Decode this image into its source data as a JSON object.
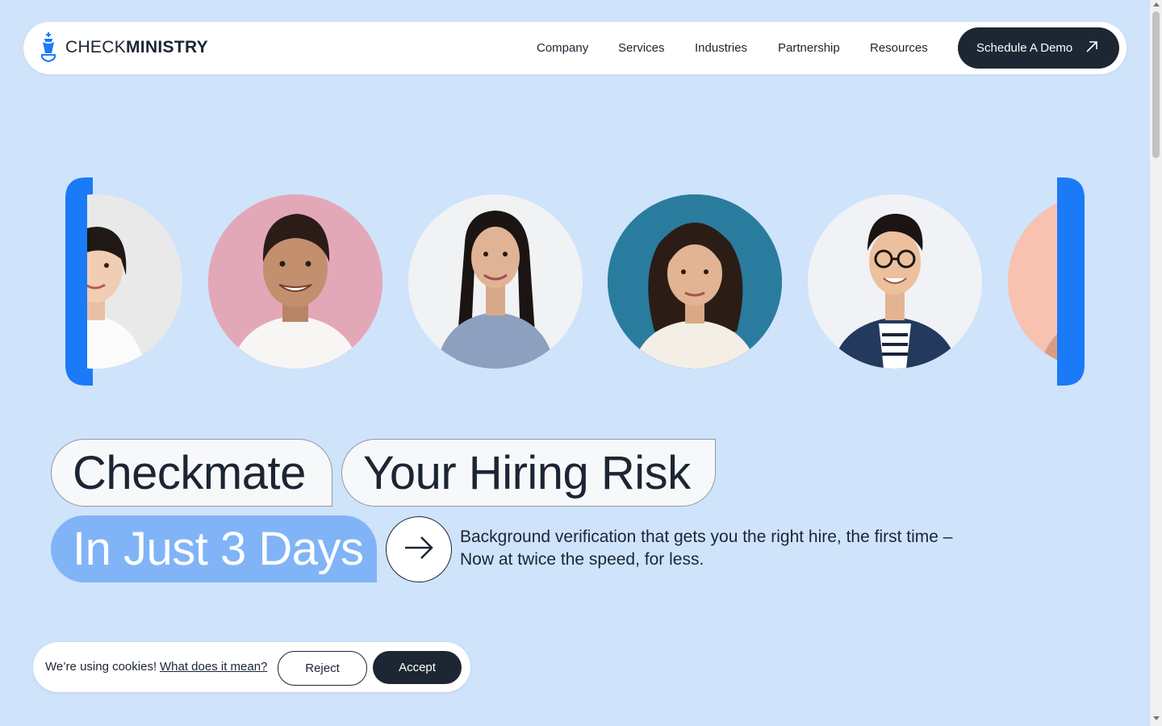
{
  "brand": {
    "name_light": "CHECK",
    "name_bold": "MINISTRY",
    "logo_icon": "chess-king-icon"
  },
  "nav": {
    "items": [
      {
        "label": "Company"
      },
      {
        "label": "Services"
      },
      {
        "label": "Industries"
      },
      {
        "label": "Partnership"
      },
      {
        "label": "Resources"
      }
    ],
    "cta_label": "Schedule A Demo",
    "cta_icon": "arrow-up-right-icon"
  },
  "carousel": {
    "accent_color": "#1a7af8",
    "avatars": [
      {
        "name": "avatar-woman-white-shirt",
        "bg": "#e9e9ea"
      },
      {
        "name": "avatar-man-pink-background",
        "bg": "#e2a8b8"
      },
      {
        "name": "avatar-woman-grey-shirt",
        "bg": "#f1f2f4"
      },
      {
        "name": "avatar-woman-teal-background",
        "bg": "#2a7c9e"
      },
      {
        "name": "avatar-man-glasses",
        "bg": "#f1f2f6"
      },
      {
        "name": "avatar-peach-partial",
        "bg": "#f7c2b0"
      }
    ]
  },
  "hero": {
    "line1": "Checkmate",
    "line2": "Your Hiring Risk",
    "line3": "In Just 3 Days",
    "arrow_icon": "arrow-right-icon",
    "tagline_1": "Background verification that gets you the right hire, the first time –",
    "tagline_2": "Now at twice the speed, for less."
  },
  "cookie": {
    "message": "We’re using cookies!",
    "link": "What does it mean?",
    "reject": "Reject",
    "accept": "Accept"
  },
  "colors": {
    "background": "#cfe3fb",
    "dark": "#1d2733",
    "highlight": "#80b4f7"
  }
}
